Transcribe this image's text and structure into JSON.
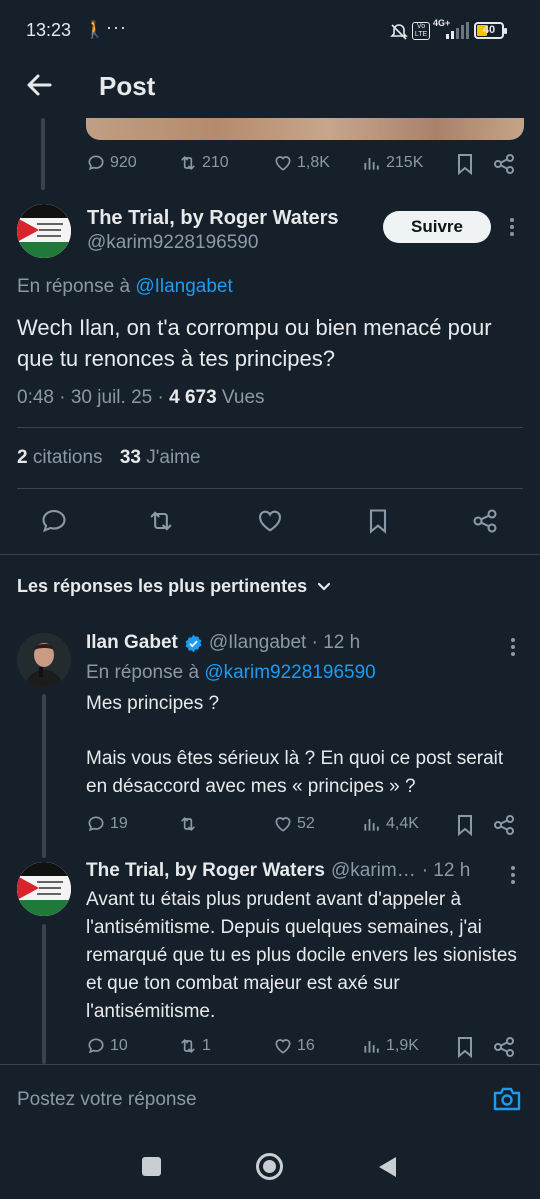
{
  "status_bar": {
    "time": "13:23",
    "battery": "40",
    "network": "4G+"
  },
  "header": {
    "title": "Post"
  },
  "prev_tweet": {
    "replies": "920",
    "retweets": "210",
    "likes": "1,8K",
    "views": "215K"
  },
  "main_tweet": {
    "name": "The Trial, by Roger Waters",
    "handle": "@karim9228196590",
    "follow_label": "Suivre",
    "reply_prefix": "En réponse à",
    "reply_handle": "@Ilangabet",
    "text": "Wech Ilan, on t'a corrompu ou bien menacé pour que tu renonces à tes principes?",
    "time": "0:48 · 30 juil. 25 ·",
    "views_count": "4 673",
    "views_label": "Vues",
    "quotes_count": "2",
    "quotes_label": "citations",
    "likes_count": "33",
    "likes_label": "J'aime"
  },
  "replies_section": {
    "title": "Les réponses les plus pertinentes"
  },
  "reply1": {
    "name": "Ilan Gabet",
    "handle": "@Ilangabet · 12 h",
    "reply_prefix": "En réponse à",
    "reply_handle": "@karim9228196590",
    "text_line1": "Mes principes ?",
    "text_line2": "Mais vous êtes sérieux là ? En quoi ce post serait en désaccord avec mes « principes » ?",
    "replies": "19",
    "retweets": "",
    "likes": "52",
    "views": "4,4K"
  },
  "reply2": {
    "name": "The Trial, by Roger Waters",
    "handle": "@karim…",
    "time": "· 12 h",
    "text": "Avant tu étais plus prudent avant d'appeler à l'antisémitisme. Depuis quelques semaines, j'ai remarqué que tu es plus docile envers les sionistes et que ton combat majeur est axé sur l'antisémitisme.",
    "replies": "10",
    "retweets": "1",
    "likes": "16",
    "views": "1,9K"
  },
  "compose": {
    "placeholder": "Postez votre réponse"
  },
  "colors": {
    "background": "#15202b",
    "accent": "#1d9bf0",
    "muted": "#8b98a5"
  }
}
